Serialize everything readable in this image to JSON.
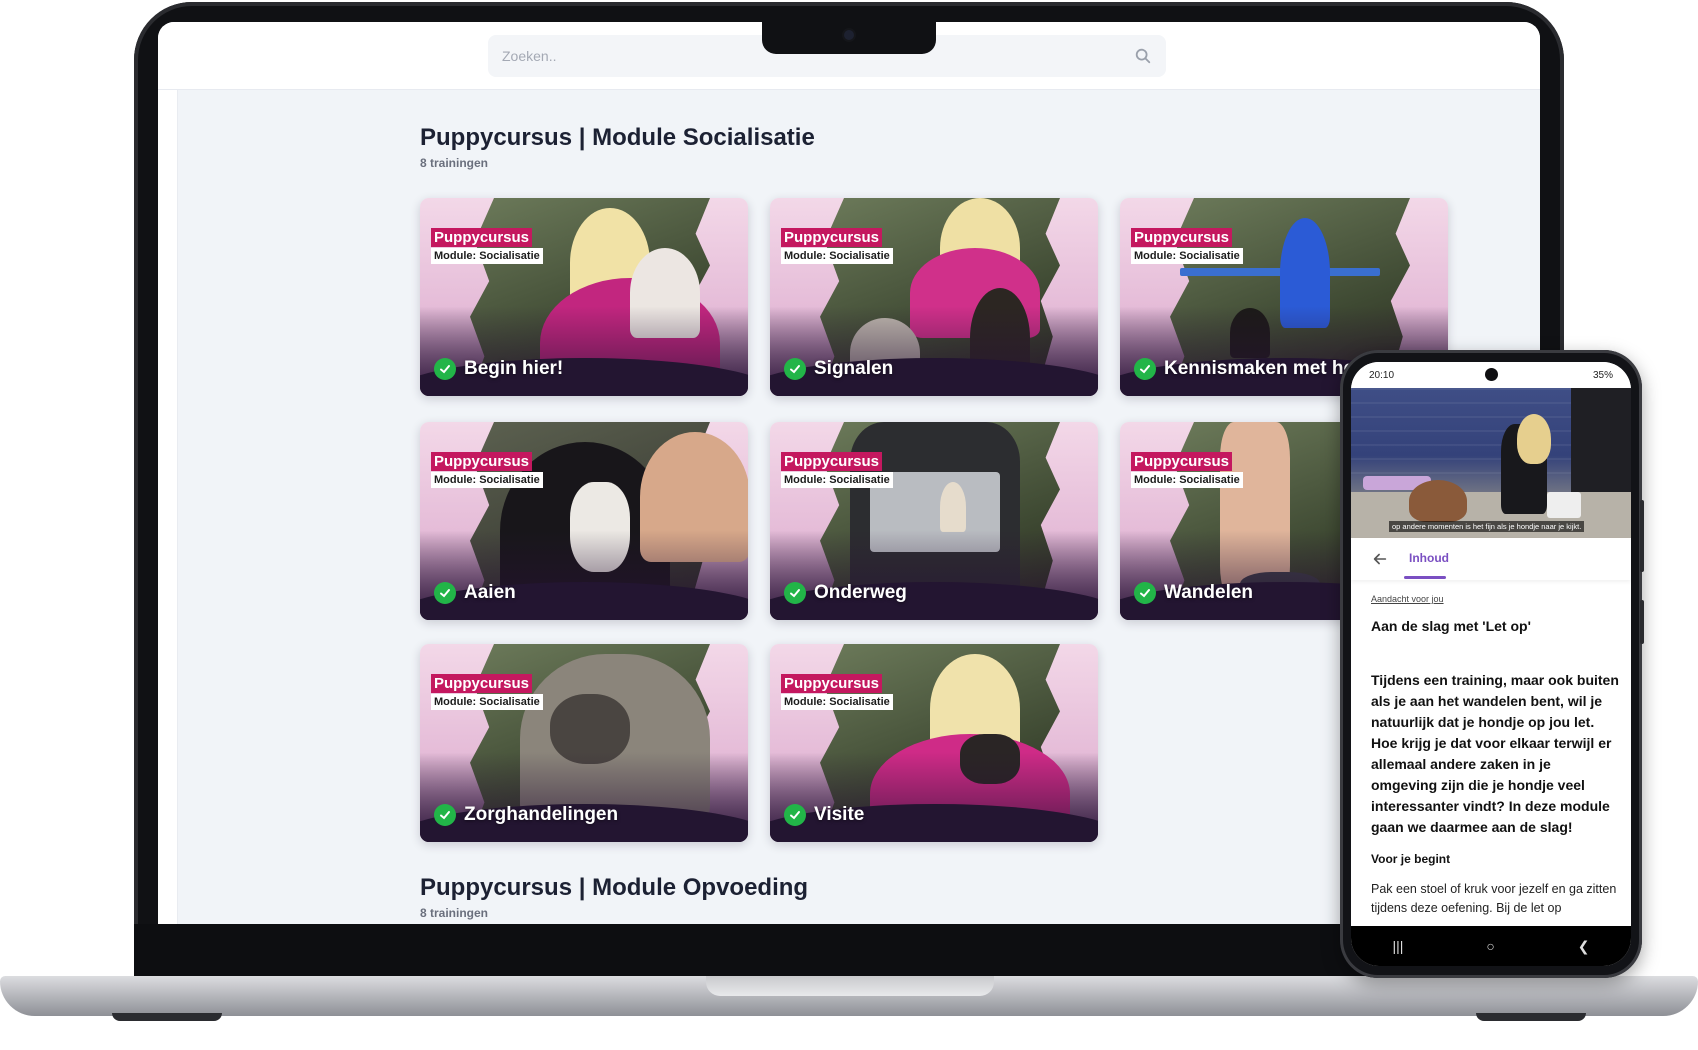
{
  "search": {
    "placeholder": "Zoeken.."
  },
  "sections": [
    {
      "title": "Puppycursus | Module Socialisatie",
      "count": "8 trainingen"
    },
    {
      "title": "Puppycursus | Module Opvoeding",
      "count": "8 trainingen"
    }
  ],
  "cards": [
    {
      "brand": "Puppycursus",
      "module": "Module: Socialisatie",
      "label": "Begin hier!"
    },
    {
      "brand": "Puppycursus",
      "module": "Module: Socialisatie",
      "label": "Signalen"
    },
    {
      "brand": "Puppycursus",
      "module": "Module: Socialisatie",
      "label": "Kennismaken met het gezin"
    },
    {
      "brand": "Puppycursus",
      "module": "Module: Socialisatie",
      "label": "Aaien"
    },
    {
      "brand": "Puppycursus",
      "module": "Module: Socialisatie",
      "label": "Onderweg"
    },
    {
      "brand": "Puppycursus",
      "module": "Module: Socialisatie",
      "label": "Wandelen"
    },
    {
      "brand": "Puppycursus",
      "module": "Module: Socialisatie",
      "label": "Zorghandelingen"
    },
    {
      "brand": "Puppycursus",
      "module": "Module: Socialisatie",
      "label": "Visite"
    }
  ],
  "phone": {
    "status": {
      "time": "20:10",
      "battery": "35%"
    },
    "subtitle": "op andere momenten is het fijn als je hondje naar je kijkt.",
    "tab": "Inhoud",
    "attention_link": "Aandacht voor jou",
    "heading": "Aan de slag met 'Let op'",
    "intro": "Tijdens een training, maar ook buiten als je aan het wandelen bent, wil je natuurlijk dat je hondje op jou let. Hoe krijg je dat voor elkaar terwijl er allemaal andere zaken in je omgeving zijn die je hondje veel interessanter vindt? In deze module gaan we daarmee aan de slag!",
    "subheading": "Voor je begint",
    "body": "Pak een stoel of kruk voor jezelf en ga zitten tijdens deze oefening. Bij de let op"
  },
  "colors": {
    "brand_pink": "#c4185f",
    "accent_purple": "#7a4fc2",
    "check_green": "#22b548"
  }
}
